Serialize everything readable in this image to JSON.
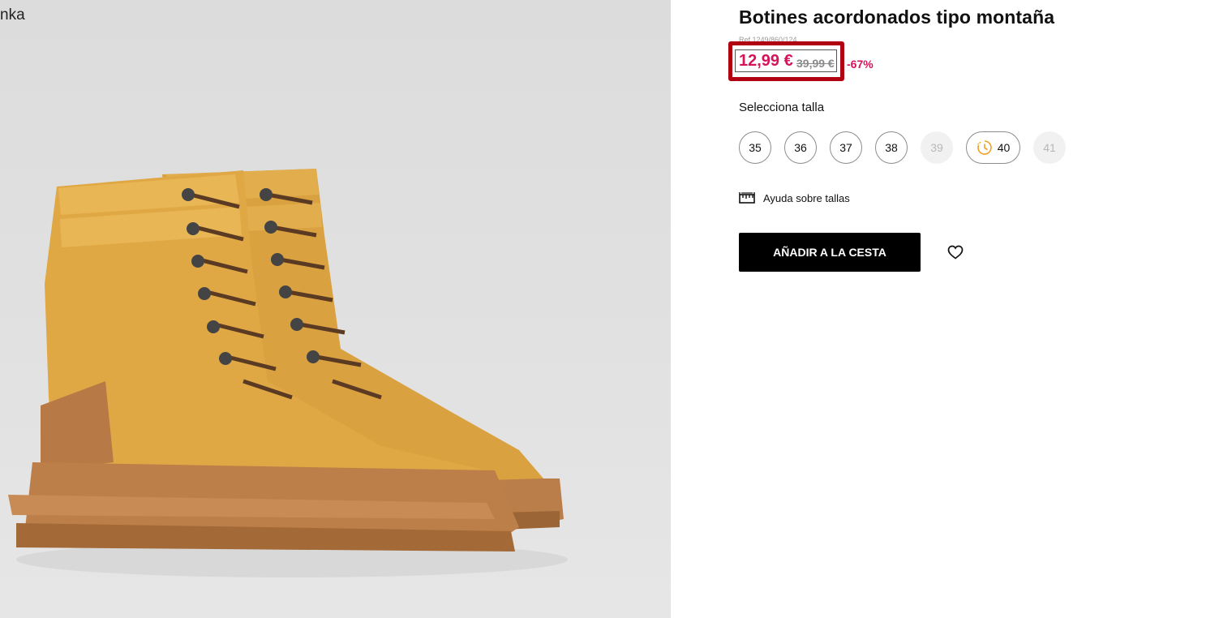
{
  "image": {
    "overlay_text": "nka"
  },
  "product": {
    "title": "Botines acordonados tipo montaña",
    "ref": "Ref.1249/860/124",
    "price_current": "12,99 €",
    "price_old": "39,99 €",
    "discount": "-67%"
  },
  "sizes": {
    "label": "Selecciona talla",
    "options": [
      {
        "label": "35",
        "available": true
      },
      {
        "label": "36",
        "available": true
      },
      {
        "label": "37",
        "available": true
      },
      {
        "label": "38",
        "available": true
      },
      {
        "label": "39",
        "available": false
      },
      {
        "label": "40",
        "available": true,
        "icon": "clock-icon"
      },
      {
        "label": "41",
        "available": false
      }
    ],
    "help_label": "Ayuda sobre tallas",
    "help_icon": "ruler-icon"
  },
  "actions": {
    "add_to_cart": "AÑADIR A LA CESTA",
    "favorite_icon": "heart-icon"
  },
  "colors": {
    "price": "#d5135b",
    "highlight_border": "#b00012",
    "button": "#000000",
    "clock_icon": "#f0a020"
  }
}
